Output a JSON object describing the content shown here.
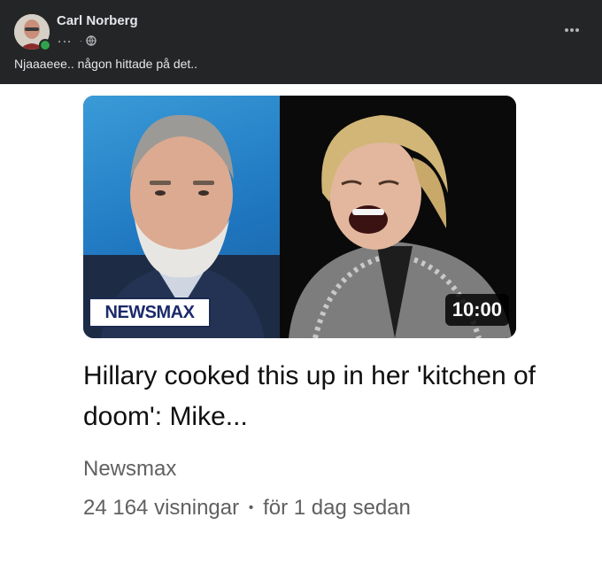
{
  "post": {
    "author": "Carl Norberg",
    "text": "Njaaaeee.. någon hittade på det..",
    "visibility_icon": "globe-icon",
    "more_icon": "more-dots-icon"
  },
  "video": {
    "channel_logo": "NEWSMAX",
    "duration": "10:00",
    "title": "Hillary cooked this up in her 'kitchen of doom': Mike...",
    "channel": "Newsmax",
    "views": "24 164 visningar",
    "separator": "•",
    "age": "för 1 dag sedan"
  },
  "colors": {
    "header_bg": "#242526",
    "online": "#31a24c",
    "newsmax_blue": "#1b2a6b"
  }
}
